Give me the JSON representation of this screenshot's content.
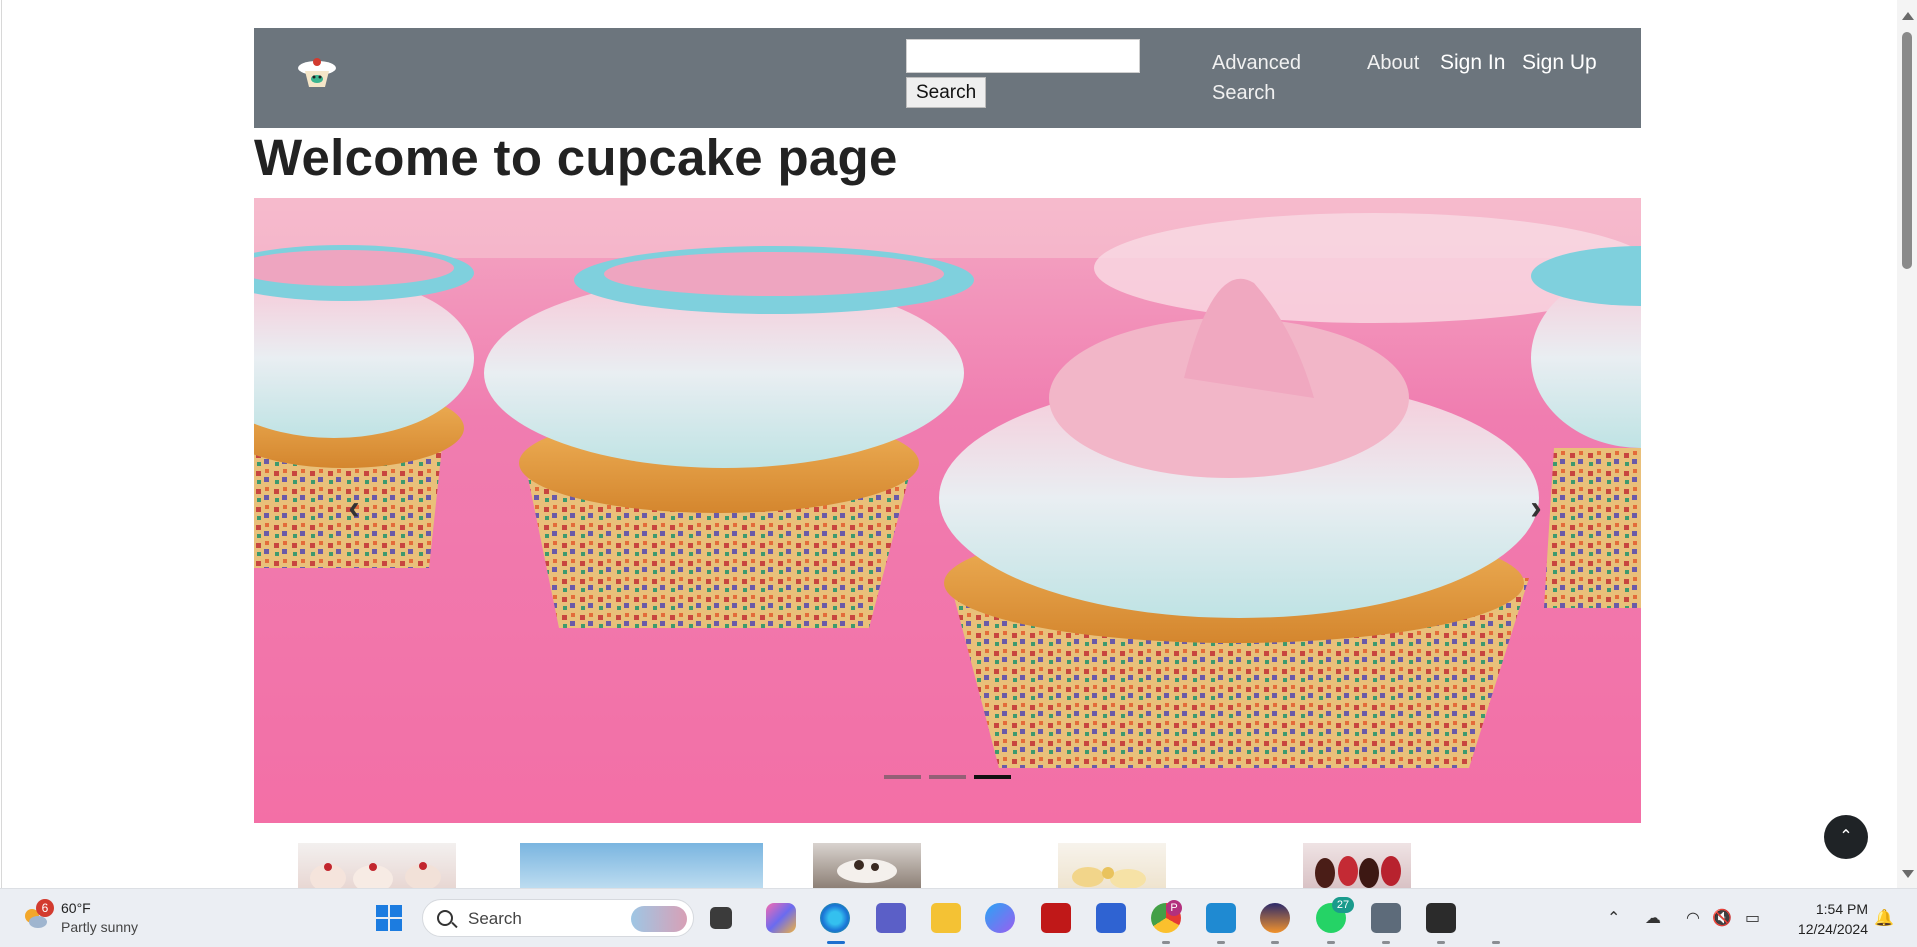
{
  "navbar": {
    "search_placeholder": "",
    "search_button": "Search",
    "advanced_search": "Advanced Search",
    "about": "About",
    "sign_in": "Sign In",
    "sign_up": "Sign Up",
    "logo_icon": "cupcake-logo-icon"
  },
  "page": {
    "title": "Welcome to cupcake page"
  },
  "carousel": {
    "prev_icon": "‹",
    "next_icon": "›",
    "slide_count": 3,
    "active_slide": 3
  },
  "back_to_top_icon": "⌃",
  "taskbar": {
    "weather": {
      "badge": "6",
      "temp": "60°F",
      "desc": "Partly sunny"
    },
    "search_label": "Search",
    "whatsapp_badge": "27",
    "chrome_badge": "P",
    "time": "1:54 PM",
    "date": "12/24/2024"
  },
  "colors": {
    "navbar_bg": "#6c757d",
    "carousel_bg": "#f27bb0",
    "title_color": "#222222",
    "taskbar_bg": "#ebeef3",
    "accent": "#1d6fce"
  }
}
